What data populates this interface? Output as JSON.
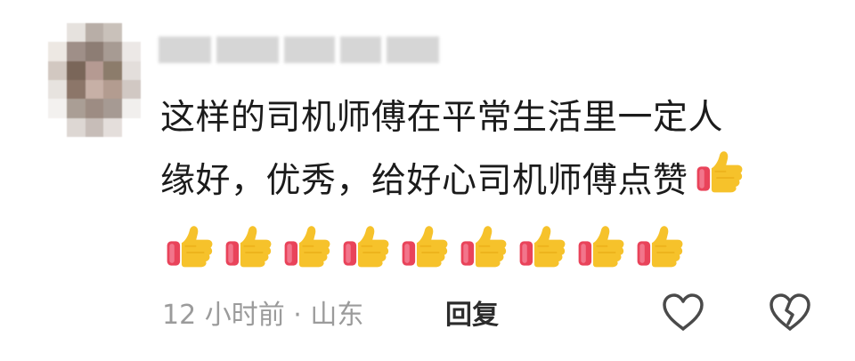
{
  "comment": {
    "username_obscured": true,
    "text_line1": "这样的司机师傅在平常生活里一定人",
    "text_line2": "缘好，优秀，给好心司机师傅点赞",
    "emoji": "thumbs-up-icon",
    "emoji_count_inline": 1,
    "emoji_count_row": 9
  },
  "footer": {
    "meta": "12 小时前 · 山东",
    "reply_label": "回复",
    "like_icon": "heart-icon",
    "dislike_icon": "broken-heart-icon"
  },
  "colors": {
    "text": "#1b1b1b",
    "meta": "#9b9b9b",
    "thumb_yellow": "#f6c22b",
    "thumb_red": "#e9435a"
  }
}
